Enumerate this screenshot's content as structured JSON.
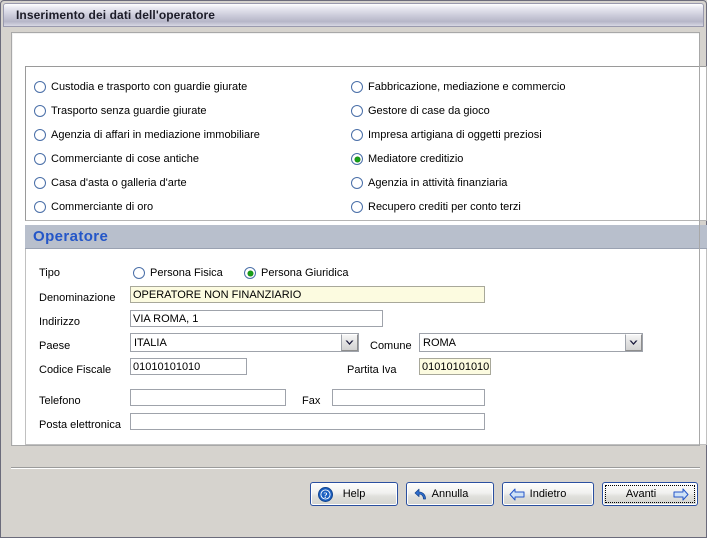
{
  "window": {
    "title": "Inserimento dei dati dell'operatore"
  },
  "activities": {
    "left_column": [
      {
        "label": "Custodia e trasporto con guardie giurate",
        "checked": false
      },
      {
        "label": "Trasporto senza guardie giurate",
        "checked": false
      },
      {
        "label": "Agenzia di affari in mediazione immobiliare",
        "checked": false
      },
      {
        "label": "Commerciante di cose antiche",
        "checked": false
      },
      {
        "label": "Casa d'asta o galleria d'arte",
        "checked": false
      },
      {
        "label": "Commerciante di oro",
        "checked": false
      }
    ],
    "right_column": [
      {
        "label": "Fabbricazione, mediazione e commercio",
        "checked": false
      },
      {
        "label": "Gestore di case da gioco",
        "checked": false
      },
      {
        "label": "Impresa artigiana di oggetti preziosi",
        "checked": false
      },
      {
        "label": "Mediatore creditizio",
        "checked": true
      },
      {
        "label": "Agenzia in attività finanziaria",
        "checked": false
      },
      {
        "label": "Recupero crediti per conto terzi",
        "checked": false
      }
    ]
  },
  "operatore": {
    "section_title": "Operatore",
    "tipo": {
      "label": "Tipo",
      "options": [
        {
          "label": "Persona Fisica",
          "checked": false
        },
        {
          "label": "Persona Giuridica",
          "checked": true
        }
      ]
    },
    "fields": {
      "denominazione": {
        "label": "Denominazione",
        "value": "OPERATORE NON FINANZIARIO",
        "placeholder": ""
      },
      "indirizzo": {
        "label": "Indirizzo",
        "value": "VIA ROMA, 1",
        "placeholder": ""
      },
      "paese": {
        "label": "Paese",
        "value": "ITALIA"
      },
      "comune": {
        "label": "Comune",
        "value": "ROMA"
      },
      "codice_fiscale": {
        "label": "Codice Fiscale",
        "value": "01010101010",
        "placeholder": ""
      },
      "partita_iva": {
        "label": "Partita Iva",
        "value": "01010101010",
        "placeholder": ""
      },
      "telefono": {
        "label": "Telefono",
        "value": "",
        "placeholder": ""
      },
      "fax": {
        "label": "Fax",
        "value": "",
        "placeholder": ""
      },
      "posta_elettronica": {
        "label": "Posta elettronica",
        "value": "",
        "placeholder": ""
      }
    }
  },
  "buttons": {
    "help": "Help",
    "annulla": "Annulla",
    "indietro": "Indietro",
    "avanti": "Avanti"
  },
  "colors": {
    "accent_blue": "#2456c8",
    "section_header_bg": "#b8bfcc",
    "radio_checked_green": "#18a018",
    "required_field_bg": "#fcfbe0",
    "button_border": "#2a4fa0",
    "window_bg": "#d6d3ce"
  }
}
